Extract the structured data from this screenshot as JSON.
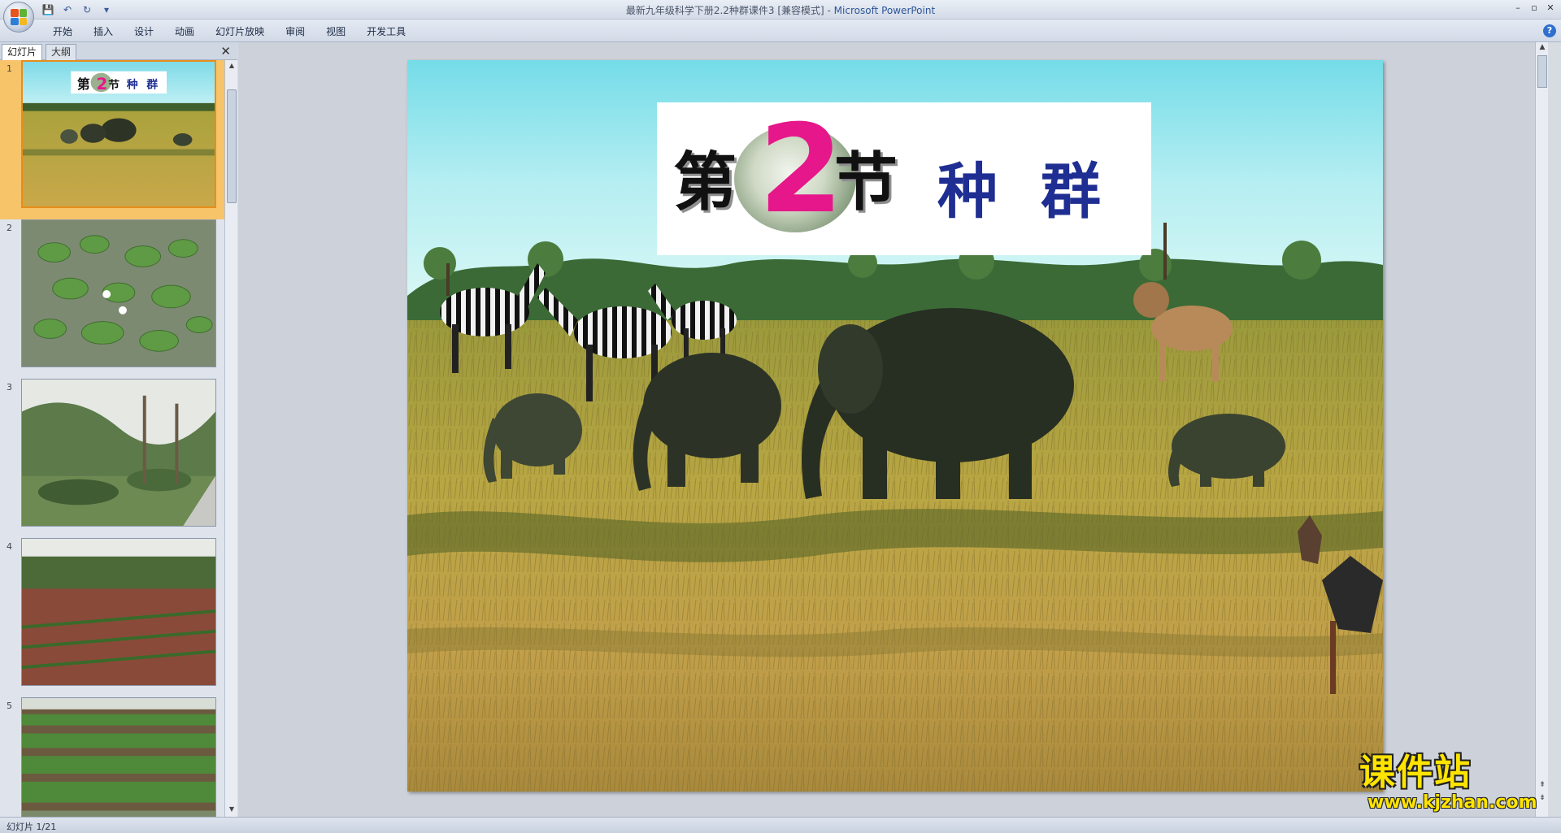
{
  "window": {
    "title": "最新九年级科学下册2.2种群课件3 [兼容模式] - ",
    "app_name": "Microsoft PowerPoint",
    "minimize": "–",
    "restore": "▫",
    "close": "✕"
  },
  "quick_access": {
    "save_icon": "💾",
    "undo_icon": "↶",
    "redo_icon": "↻",
    "customize_icon": "▾"
  },
  "ribbon": {
    "tabs": [
      "开始",
      "插入",
      "设计",
      "动画",
      "幻灯片放映",
      "审阅",
      "视图",
      "开发工具"
    ],
    "help": "?"
  },
  "left_pane": {
    "tab_slides": "幻灯片",
    "tab_outline": "大纲",
    "close": "✕",
    "thumbnails": [
      {
        "number": "1",
        "selected": true,
        "scene": "savanna"
      },
      {
        "number": "2",
        "selected": false,
        "scene": "lily-pond"
      },
      {
        "number": "3",
        "selected": false,
        "scene": "garden-path"
      },
      {
        "number": "4",
        "selected": false,
        "scene": "farm-field"
      },
      {
        "number": "5",
        "selected": false,
        "scene": "vegetable-rows"
      }
    ]
  },
  "slide": {
    "title_di": "第",
    "title_num": "2",
    "title_jie": "节",
    "title_zhong": "种",
    "title_qun": "群"
  },
  "status": {
    "text": "幻灯片 1/21"
  },
  "watermark": {
    "name": "课件站",
    "url": "www.kjzhan.com"
  },
  "colors": {
    "title_num": "#e6178a",
    "title_text": "#1e2e92",
    "selection": "#f7c46a",
    "watermark": "#ffe400"
  }
}
